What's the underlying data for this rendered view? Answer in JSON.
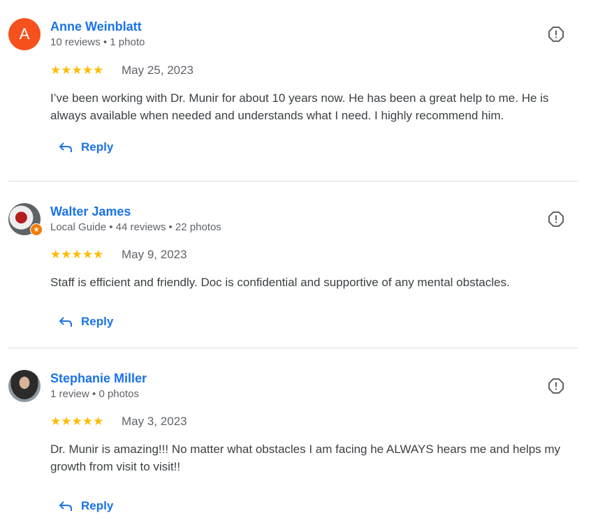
{
  "reviews": [
    {
      "avatar_letter": "A",
      "name": "Anne Weinblatt",
      "meta": "10 reviews • 1 photo",
      "stars": "★★★★★",
      "rating": 5,
      "date": "May 25, 2023",
      "text": "I’ve been working with Dr. Munir for about 10 years now. He has been a great help to me. He is always available when needed and understands what I need. I highly recommend him.",
      "reply_label": "Reply"
    },
    {
      "name": "Walter James",
      "meta": "Local Guide • 44 reviews • 22 photos",
      "stars": "★★★★★",
      "rating": 5,
      "date": "May 9, 2023",
      "text": "Staff is efficient and friendly. Doc is confidential and supportive of any mental obstacles.",
      "reply_label": "Reply"
    },
    {
      "name": "Stephanie Miller",
      "meta": "1 review • 0 photos",
      "stars": "★★★★★",
      "rating": 5,
      "date": "May 3, 2023",
      "text": "Dr. Munir is amazing!!! No matter what obstacles I am facing he ALWAYS hears me and helps my growth from visit to visit!!",
      "reply_label": "Reply"
    }
  ],
  "icons": {
    "flag": "report-flag-icon",
    "reply": "reply-arrow-icon",
    "guide": "local-guide-star-icon"
  },
  "colors": {
    "accent": "#1a73e8",
    "star": "#fbbc04",
    "avatar_a": "#f4511e",
    "guide_badge": "#f57c00"
  }
}
